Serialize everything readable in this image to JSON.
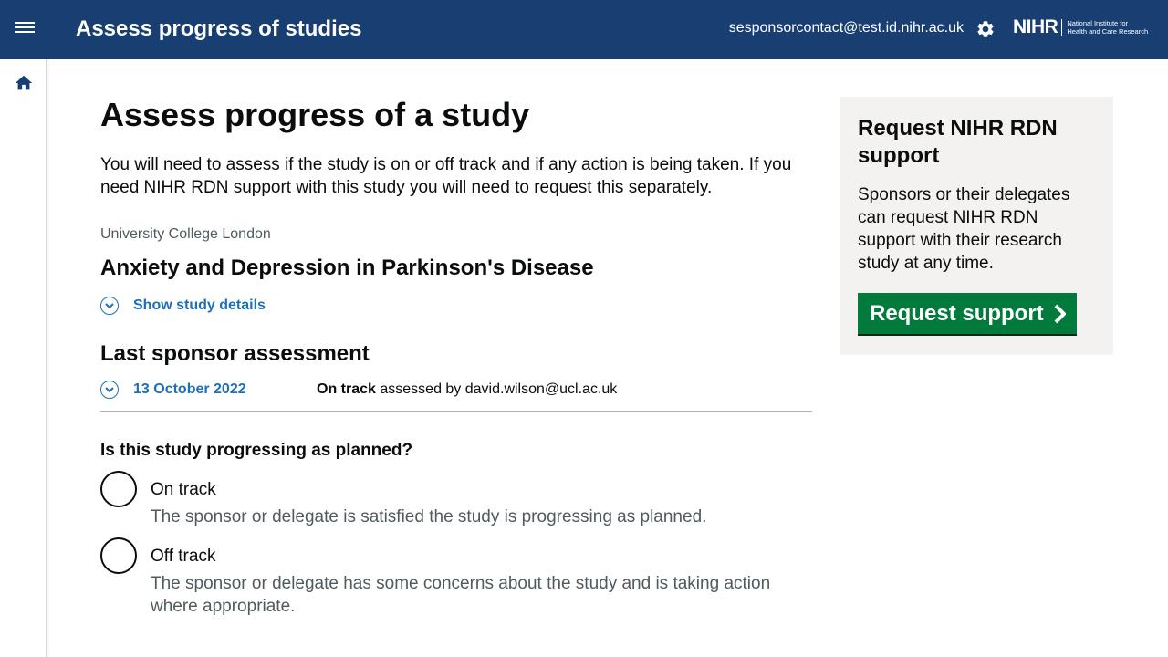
{
  "header": {
    "title": "Assess progress of studies",
    "user_email": "sesponsorcontact@test.id.nihr.ac.uk",
    "logo_main": "NIHR",
    "logo_sub_line1": "National Institute for",
    "logo_sub_line2": "Health and Care Research",
    "menu_icon": "menu-icon",
    "settings_icon": "gear-icon"
  },
  "sidebar": {
    "home_icon": "home-icon"
  },
  "main": {
    "page_title": "Assess progress of a study",
    "intro": "You will need to assess if the study is on or off track and if any action is being taken. If you need NIHR RDN support with this study you will need to request this separately.",
    "organisation": "University College London",
    "study_title": "Anxiety and Depression in Parkinson's Disease",
    "show_details_label": "Show study details",
    "last_assessment_heading": "Last sponsor assessment",
    "last_assessment": {
      "date": "13 October 2022",
      "status": "On track",
      "assessed_by_text": " assessed by david.wilson@ucl.ac.uk"
    },
    "question": "Is this study progressing as planned?",
    "options": [
      {
        "label": "On track",
        "hint": "The sponsor or delegate is satisfied the study is progressing as planned."
      },
      {
        "label": "Off track",
        "hint": "The sponsor or delegate has some concerns about the study and is taking action where appropriate."
      }
    ]
  },
  "aside": {
    "title": "Request NIHR RDN support",
    "body": "Sponsors or their delegates can request NIHR RDN support with their research study at any time.",
    "button_label": "Request support"
  },
  "colors": {
    "header_bg": "#193e72",
    "link": "#1d70b8",
    "button_green": "#007b3c",
    "aside_bg": "#f3f2f1"
  }
}
